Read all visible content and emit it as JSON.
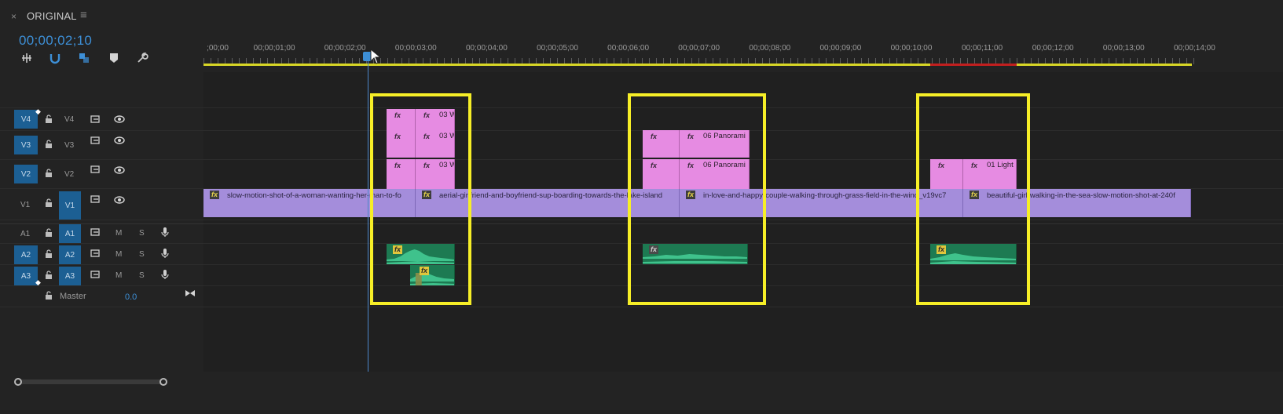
{
  "panel": {
    "close_glyph": "×",
    "title": "ORIGINAL",
    "menu_glyph": "≡"
  },
  "timecode": "00;00;02;10",
  "tools": [
    {
      "name": "insert-sequence-nest-icon",
      "glyph": "⫶"
    },
    {
      "name": "snap-magnet-icon",
      "glyph": "∩"
    },
    {
      "name": "linked-selection-icon",
      "glyph": "◥"
    },
    {
      "name": "add-marker-icon",
      "glyph": "♥"
    },
    {
      "name": "wrench-settings-icon",
      "glyph": "🔧"
    }
  ],
  "ruler": {
    "labels": [
      "00;00",
      "00;00;01;00",
      "00;00;02;00",
      "00;00;03;00",
      "00;00;04;00",
      "00;00;05;00",
      "00;00;06;00",
      "00;00;07;00",
      "00;00;08;00",
      "00;00;09;00",
      "00;00;10;00",
      "00;00;11;00",
      "00;00;12;00",
      "00;00;13;00",
      "00;00;14;00"
    ],
    "first_label_display": ";00;00"
  },
  "tracks": {
    "video": [
      {
        "id": "V4",
        "src": "V4",
        "label": "V4"
      },
      {
        "id": "V3",
        "src": "V3",
        "label": "V3"
      },
      {
        "id": "V2",
        "src": "V2",
        "label": "V2"
      },
      {
        "id": "V1",
        "src": "V1",
        "label": "V1"
      }
    ],
    "audio": [
      {
        "id": "A1",
        "src": "A1",
        "label": "A1",
        "m": "M",
        "s": "S"
      },
      {
        "id": "A2",
        "src": "A2",
        "label": "A2",
        "m": "M",
        "s": "S"
      },
      {
        "id": "A3",
        "src": "A3",
        "label": "A3",
        "m": "M",
        "s": "S"
      }
    ],
    "master": {
      "label": "Master",
      "value": "0.0"
    }
  },
  "clips": {
    "fx": "fx",
    "v4_a": "03 W",
    "v3_a": "03 W",
    "v2_a": "03 W",
    "v3_b": "06 Panorami",
    "v2_b": "06 Panorami",
    "v2_c": "01 Light",
    "v1_1": "slow-motion-shot-of-a-woman-wanting-her-man-to-fo",
    "v1_2": "aerial-girlfriend-and-boyfriend-sup-boarding-towards-the-lake-island",
    "v1_3": "in-love-and-happy-couple-walking-through-grass-field-in-the-wind_v19vc7",
    "v1_4": "beautiful-girl-walking-in-the-sea-slow-motion-shot-at-240f"
  },
  "colors": {
    "accent_blue": "#3d8fd6",
    "video_clip": "#e68be2",
    "v1_clip": "#a48ddb",
    "audio_clip": "#1d7a52",
    "highlight_box": "#f6ee27",
    "work_area_bar": "#d8d626"
  }
}
